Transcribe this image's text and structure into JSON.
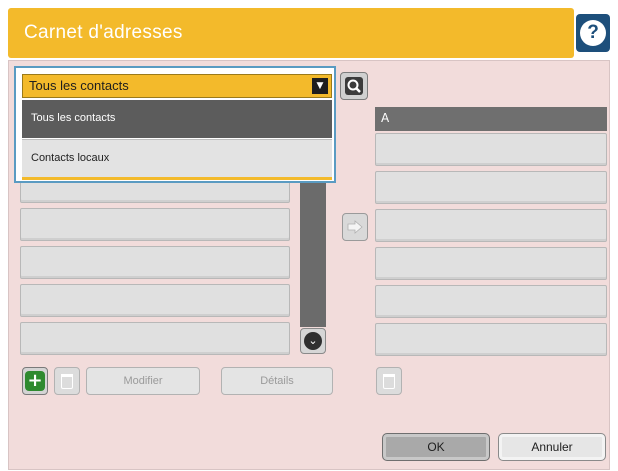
{
  "header": {
    "title": "Carnet d'adresses",
    "help_label": "?"
  },
  "dropdown": {
    "selected": "Tous les contacts",
    "options": [
      "Tous les contacts",
      "Contacts locaux"
    ]
  },
  "right_list": {
    "header": "A"
  },
  "buttons": {
    "modifier": "Modifier",
    "details": "Détails",
    "ok": "OK",
    "cancel": "Annuler"
  },
  "icons": {
    "help": "help-icon",
    "search": "search-icon",
    "add": "add-icon",
    "delete": "trash-icon",
    "arrow": "arrow-right-icon",
    "scroll": "chevron-down-icon"
  },
  "colors": {
    "accent": "#f3ba2b",
    "help": "#1d4f7b",
    "panel": "#f2dcdb"
  }
}
